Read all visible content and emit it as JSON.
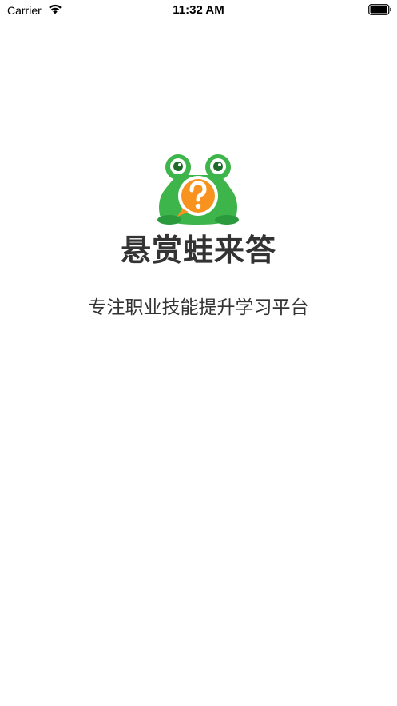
{
  "status_bar": {
    "carrier": "Carrier",
    "time": "11:32 AM",
    "wifi_icon": "wifi-icon",
    "battery_icon": "battery-full-icon"
  },
  "splash": {
    "logo_icon": "frog-question-logo-icon",
    "app_name": "悬赏蛙来答",
    "tagline": "专注职业技能提升学习平台",
    "colors": {
      "frog_green": "#3DB54A",
      "frog_dark_green": "#2A9A3C",
      "bubble_orange": "#F7931E",
      "text": "#333333",
      "background": "#FFFFFF"
    }
  }
}
